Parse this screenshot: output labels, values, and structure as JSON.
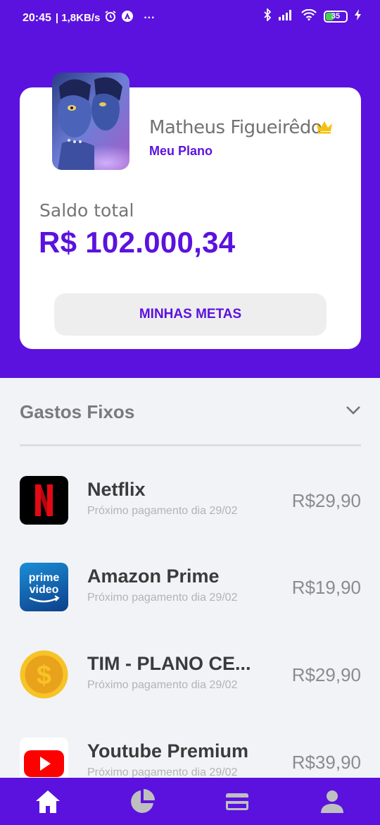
{
  "status_bar": {
    "time": "20:45",
    "speed": "| 1,8KB/s",
    "more": "···",
    "battery": "35",
    "icons": [
      "alarm-icon",
      "android-icon",
      "bluetooth-icon",
      "signal-icon",
      "wifi-icon",
      "battery-icon",
      "charging-icon"
    ]
  },
  "profile": {
    "name": "Matheus Figueirêdo",
    "plan_link": "Meu Plano",
    "balance_label": "Saldo total",
    "balance_value": "R$ 102.000,34",
    "goals_button": "MINHAS METAS",
    "icons": [
      "avatar-image",
      "crown-icon"
    ]
  },
  "fixed_expenses": {
    "title": "Gastos Fixos",
    "items": [
      {
        "name": "Netflix",
        "subtitle": "Próximo pagamento dia 29/02",
        "price": "R$29,90",
        "icon": "netflix-icon"
      },
      {
        "name": "Amazon Prime",
        "subtitle": "Próximo pagamento dia 29/02",
        "price": "R$19,90",
        "icon": "prime-video-icon"
      },
      {
        "name": "TIM - PLANO CE...",
        "subtitle": "Próximo pagamento dia 29/02",
        "price": "R$29,90",
        "icon": "dollar-coin-icon"
      },
      {
        "name": "Youtube Premium",
        "subtitle": "Próximo pagamento dia 29/02",
        "price": "R$39,90",
        "icon": "youtube-icon"
      }
    ],
    "logo_text": {
      "netflix": "N",
      "prime_top": "prime",
      "prime_bottom": "video",
      "coin": "$"
    }
  },
  "bottom_nav": {
    "items": [
      "home-icon",
      "pie-chart-icon",
      "credit-card-icon",
      "profile-icon"
    ],
    "active": "home-icon"
  },
  "colors": {
    "brand": "#5b12de",
    "nav_active": "#ffffff",
    "nav_inactive": "#bfbfbf",
    "crown": "#f4c20d"
  }
}
